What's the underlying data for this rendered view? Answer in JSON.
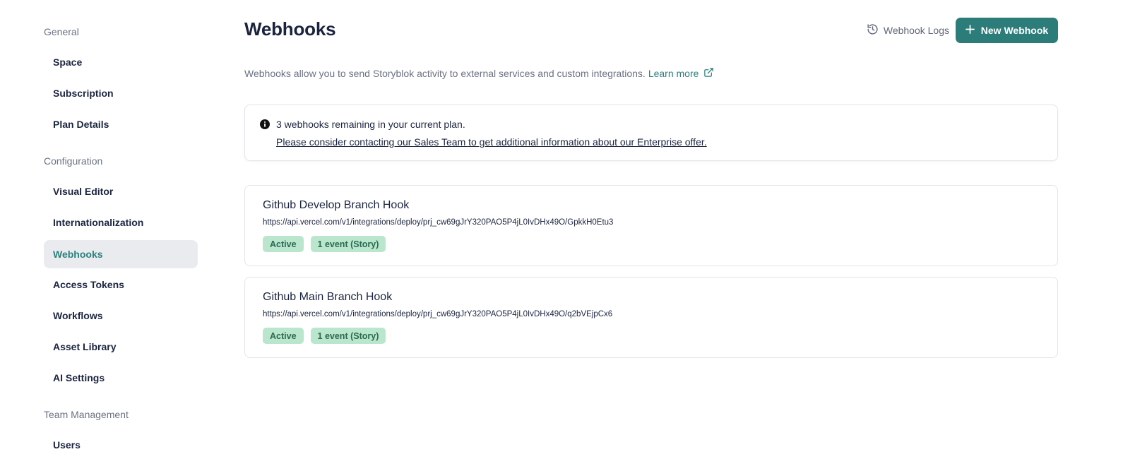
{
  "sidebar": {
    "sections": [
      {
        "title": "General",
        "items": [
          {
            "label": "Space"
          },
          {
            "label": "Subscription"
          },
          {
            "label": "Plan Details"
          }
        ]
      },
      {
        "title": "Configuration",
        "items": [
          {
            "label": "Visual Editor"
          },
          {
            "label": "Internationalization"
          },
          {
            "label": "Webhooks",
            "active": true
          },
          {
            "label": "Access Tokens"
          },
          {
            "label": "Workflows"
          },
          {
            "label": "Asset Library"
          },
          {
            "label": "AI Settings"
          }
        ]
      },
      {
        "title": "Team Management",
        "items": [
          {
            "label": "Users"
          }
        ]
      }
    ]
  },
  "header": {
    "title": "Webhooks",
    "logs_label": "Webhook Logs",
    "new_button_label": "New Webhook"
  },
  "description": {
    "text": "Webhooks allow you to send Storyblok activity to external services and custom integrations.",
    "learn_more": "Learn more"
  },
  "info": {
    "text": "3 webhooks remaining in your current plan.",
    "link": "Please consider contacting our Sales Team to get additional information about our Enterprise offer."
  },
  "webhooks": [
    {
      "name": "Github Develop Branch Hook",
      "url": "https://api.vercel.com/v1/integrations/deploy/prj_cw69gJrY320PAO5P4jL0IvDHx49O/GpkkH0Etu3",
      "status": "Active",
      "events": "1 event (Story)"
    },
    {
      "name": "Github Main Branch Hook",
      "url": "https://api.vercel.com/v1/integrations/deploy/prj_cw69gJrY320PAO5P4jL0IvDHx49O/q2bVEjpCx6",
      "status": "Active",
      "events": "1 event (Story)"
    }
  ],
  "colors": {
    "accent": "#2c7c79",
    "badge_bg": "#b9e6cc",
    "badge_text": "#2b6a51",
    "active_nav_bg": "#e9ebee"
  }
}
